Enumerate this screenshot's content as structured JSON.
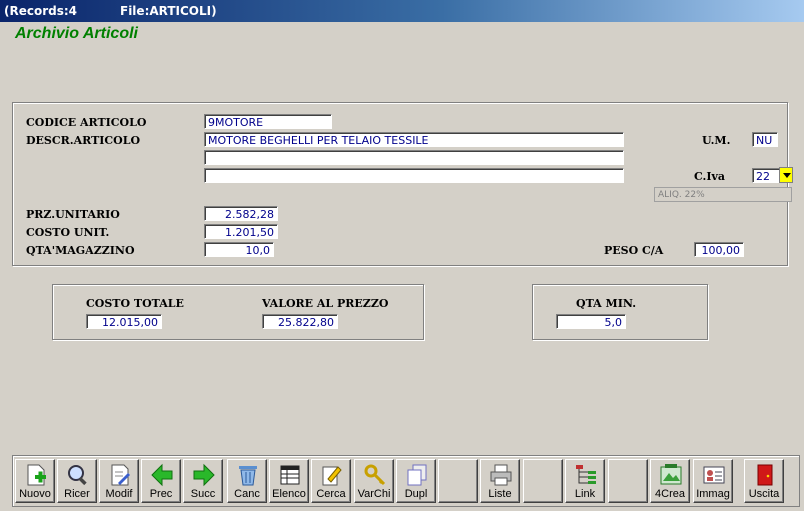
{
  "window": {
    "records": "(Records:4",
    "file": "File:ARTICOLI)"
  },
  "app_title": "Archivio Articoli",
  "form": {
    "codice_label": "CODICE ARTICOLO",
    "codice_value": "9MOTORE",
    "descr_label": "DESCR.ARTICOLO",
    "descr_value1": "MOTORE BEGHELLI PER TELAIO TESSILE",
    "descr_value2": "",
    "descr_value3": "",
    "um_label": "U.M.",
    "um_value": "NU",
    "civa_label": "C.Iva",
    "civa_value": "22",
    "aliq_value": "ALIQ. 22%",
    "prz_label": "PRZ.UNITARIO",
    "prz_value": "2.582,28",
    "costo_label": "COSTO UNIT.",
    "costo_value": "1.201,50",
    "qta_label": "QTA'MAGAZZINO",
    "qta_value": "10,0",
    "peso_label": "PESO C/A",
    "peso_value": "100,00"
  },
  "totals": {
    "costo_totale_label": "COSTO TOTALE",
    "costo_totale_value": "12.015,00",
    "valore_label": "VALORE AL PREZZO",
    "valore_value": "25.822,80",
    "qta_min_label": "QTA MIN.",
    "qta_min_value": "5,0"
  },
  "toolbar": {
    "nuovo": "Nuovo",
    "ricer": "Ricer",
    "modif": "Modif",
    "prec": "Prec",
    "succ": "Succ",
    "canc": "Canc",
    "elenco": "Elenco",
    "cerca": "Cerca",
    "varchi": "VarChi",
    "dupl": "Dupl",
    "liste": "Liste",
    "link": "Link",
    "crea4": "4Crea",
    "immag": "Immag",
    "uscita": "Uscita"
  },
  "colors": {
    "title_green": "#008000",
    "field_text": "#00008b",
    "dropdown_yellow": "#ffff00"
  }
}
